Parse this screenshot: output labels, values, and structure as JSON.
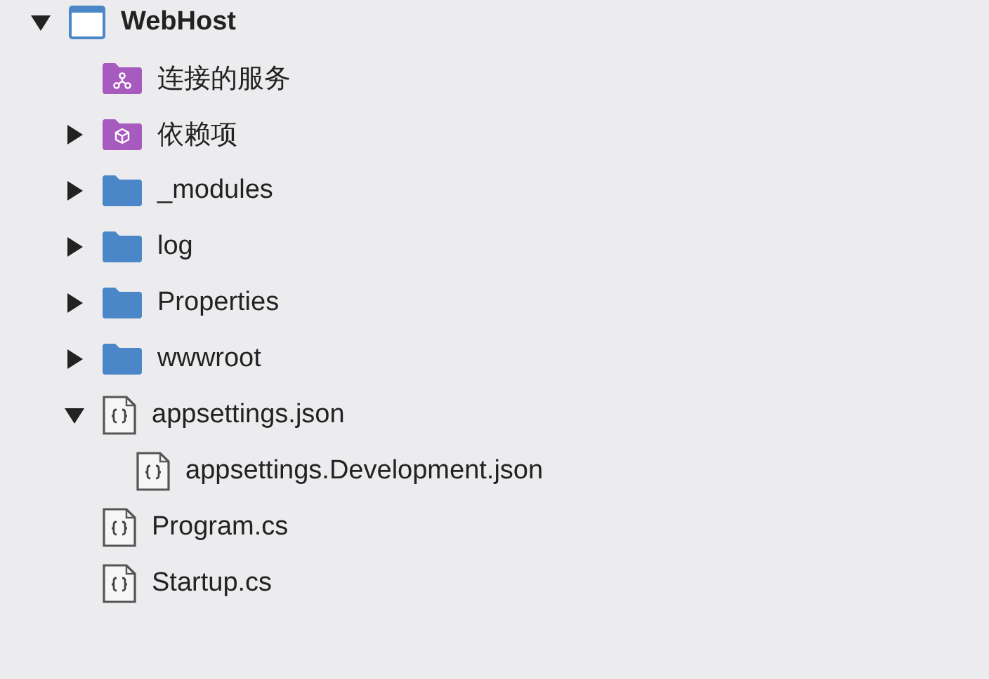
{
  "tree": [
    {
      "label": "WebHost",
      "kind": "project",
      "expanded": true,
      "children": [
        {
          "label": "连接的服务",
          "kind": "services"
        },
        {
          "label": "依赖项",
          "kind": "dependencies",
          "expanded": false
        },
        {
          "label": "_modules",
          "kind": "folder",
          "expanded": false
        },
        {
          "label": "log",
          "kind": "folder",
          "expanded": false
        },
        {
          "label": "Properties",
          "kind": "folder",
          "expanded": false
        },
        {
          "label": "wwwroot",
          "kind": "folder",
          "expanded": false
        },
        {
          "label": "appsettings.json",
          "kind": "file",
          "expanded": true,
          "children": [
            {
              "label": "appsettings.Development.json",
              "kind": "file"
            }
          ]
        },
        {
          "label": "Program.cs",
          "kind": "file"
        },
        {
          "label": "Startup.cs",
          "kind": "file"
        }
      ]
    }
  ]
}
